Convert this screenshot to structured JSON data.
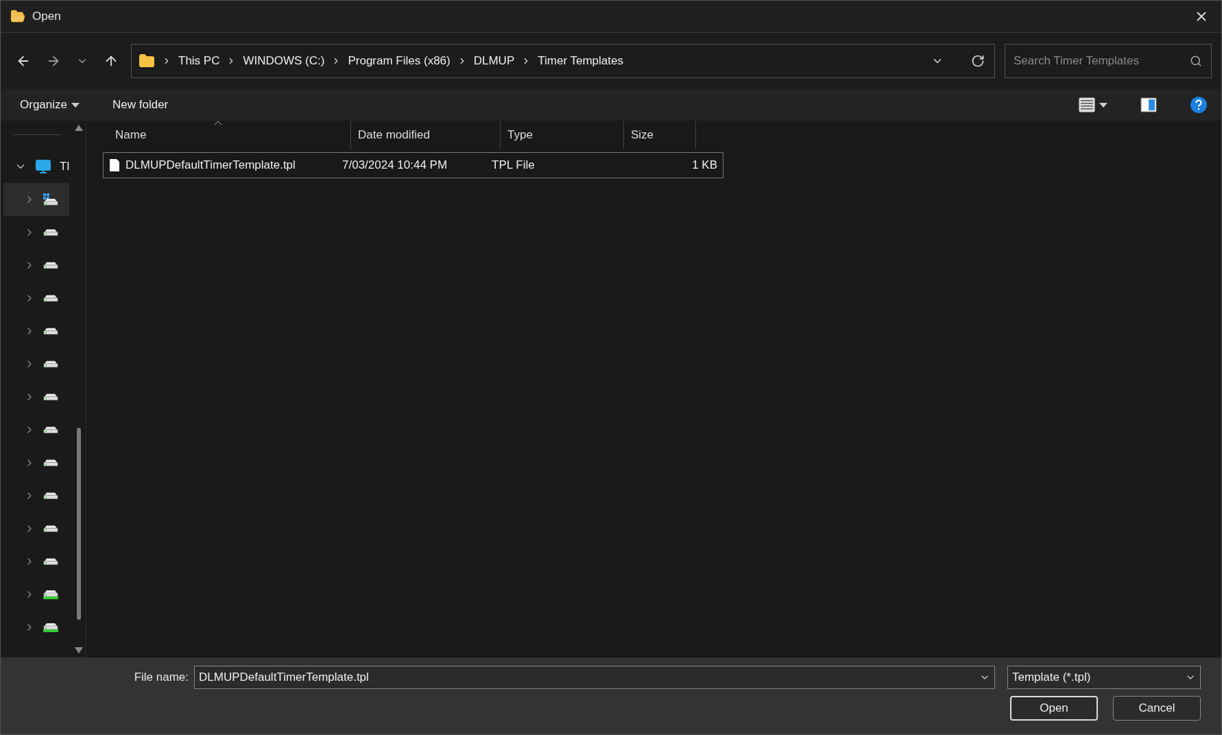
{
  "window": {
    "title": "Open"
  },
  "breadcrumb": [
    "This PC",
    "WINDOWS (C:)",
    "Program Files (x86)",
    "DLMUP",
    "Timer Templates"
  ],
  "search": {
    "placeholder": "Search Timer Templates"
  },
  "toolbar": {
    "organize": "Organize",
    "new_folder": "New folder"
  },
  "sidebar": {
    "root": {
      "label": "Tl",
      "expanded": true,
      "children": [
        {
          "kind": "system",
          "selected": true
        },
        {
          "kind": "drive",
          "selected": false
        },
        {
          "kind": "drive",
          "selected": false
        },
        {
          "kind": "drive",
          "selected": false
        },
        {
          "kind": "drive",
          "selected": false
        },
        {
          "kind": "drive",
          "selected": false
        },
        {
          "kind": "drive",
          "selected": false
        },
        {
          "kind": "drive",
          "selected": false
        },
        {
          "kind": "drive",
          "selected": false
        },
        {
          "kind": "drive",
          "selected": false
        },
        {
          "kind": "drive",
          "selected": false
        },
        {
          "kind": "drive",
          "selected": false
        },
        {
          "kind": "usb",
          "selected": false
        },
        {
          "kind": "usb",
          "selected": false
        }
      ]
    }
  },
  "table": {
    "columns": [
      {
        "label": "Name",
        "sorted": true
      },
      {
        "label": "Date modified",
        "sorted": false
      },
      {
        "label": "Type",
        "sorted": false
      },
      {
        "label": "Size",
        "sorted": false
      }
    ],
    "rows": [
      {
        "name": "DLMUPDefaultTimerTemplate.tpl",
        "date": "7/03/2024 10:44 PM",
        "type": "TPL File",
        "size": "1 KB",
        "selected": true
      }
    ]
  },
  "footer": {
    "file_name_label": "File name:",
    "file_name": "DLMUPDefaultTimerTemplate.tpl",
    "filter": "Template (*.tpl)",
    "buttons": [
      {
        "label": "Open",
        "default": true
      },
      {
        "label": "Cancel",
        "default": false
      }
    ]
  }
}
